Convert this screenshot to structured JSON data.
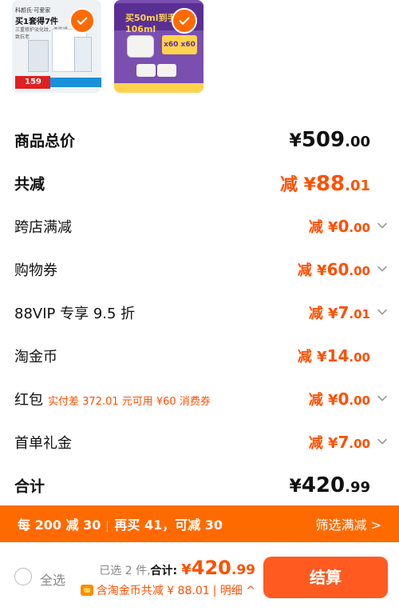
{
  "colors": {
    "accent": "#ff5000",
    "promo_bg": "#ff6a00",
    "checkout_bg": "#ff5a1f"
  },
  "thumbnails": [
    {
      "name": "product-1",
      "icon": "checkmark-icon",
      "head": "科颜氏·可爱家",
      "title": "买1套得7件",
      "sub": "三重修护淡化纹，养肤紧致抗老",
      "price": "159"
    },
    {
      "name": "product-2",
      "icon": "checkmark-icon",
      "banner": "买50ml到手106ml",
      "tag": "x60 x60"
    }
  ],
  "rows": [
    {
      "label": "商品总价",
      "value_prefix": "¥",
      "value_int": "509",
      "value_dec": ".00"
    },
    {
      "label": "共减",
      "value_prefix": "减 ¥",
      "value_int": "88",
      "value_dec": ".01"
    },
    {
      "label": "跨店满减",
      "value_prefix": "减 ¥",
      "value_int": "0",
      "value_dec": ".00"
    },
    {
      "label": "购物券",
      "value_prefix": "减 ¥",
      "value_int": "60",
      "value_dec": ".00"
    },
    {
      "label": "88VIP 专享 9.5 折",
      "value_prefix": "减 ¥",
      "value_int": "7",
      "value_dec": ".01"
    },
    {
      "label": "淘金币",
      "value_prefix": "减 ¥",
      "value_int": "14",
      "value_dec": ".00"
    },
    {
      "label": "红包",
      "note": "实付差 372.01 元可用 ¥60 消费券",
      "value_prefix": "减 ¥",
      "value_int": "0",
      "value_dec": ".00"
    },
    {
      "label": "首单礼金",
      "value_prefix": "减 ¥",
      "value_int": "7",
      "value_dec": ".00"
    },
    {
      "label": "合计",
      "value_prefix": "¥",
      "value_int": "420",
      "value_dec": ".99"
    }
  ],
  "promo": {
    "part1": "每 200 减 30",
    "part2": "再买 41，可减 30",
    "right": "筛选满减 >"
  },
  "bottom": {
    "select_all": "全选",
    "count": "已选 2 件,",
    "total_label": "合计:",
    "total_cur": "¥",
    "total_int": "420",
    "total_dec": ".99",
    "discount": "含淘金币共减 ¥ 88.01",
    "detail": "| 明细 ^",
    "checkout": "结算"
  }
}
